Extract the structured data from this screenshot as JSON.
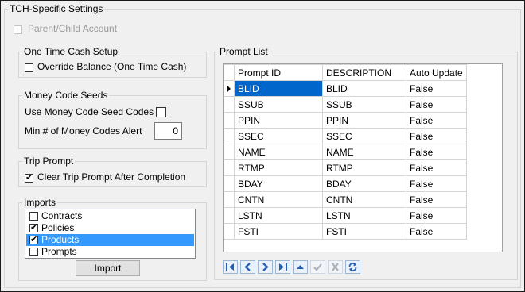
{
  "section_title": "TCH-Specific Settings",
  "parent_child": {
    "label": "Parent/Child Account",
    "checked": false,
    "enabled": false
  },
  "one_time_cash": {
    "title": "One Time Cash Setup",
    "override_label": "Override Balance (One Time Cash)",
    "override_checked": false
  },
  "money_code": {
    "title": "Money Code Seeds",
    "use_seed_label": "Use Money Code Seed Codes",
    "use_seed_checked": false,
    "min_label": "Min # of Money Codes Alert",
    "min_value": "0"
  },
  "trip_prompt": {
    "title": "Trip Prompt",
    "clear_label": "Clear Trip Prompt After Completion",
    "clear_checked": true
  },
  "imports": {
    "title": "Imports",
    "items": [
      {
        "label": "Contracts",
        "checked": false,
        "selected": false
      },
      {
        "label": "Policies",
        "checked": true,
        "selected": false
      },
      {
        "label": "Products",
        "checked": true,
        "selected": true
      },
      {
        "label": "Prompts",
        "checked": false,
        "selected": false
      }
    ],
    "import_button": "Import"
  },
  "prompt_list": {
    "title": "Prompt List",
    "columns": [
      "Prompt ID",
      "DESCRIPTION",
      "Auto Update"
    ],
    "rows": [
      [
        "BLID",
        "BLID",
        "False"
      ],
      [
        "SSUB",
        "SSUB",
        "False"
      ],
      [
        "PPIN",
        "PPIN",
        "False"
      ],
      [
        "SSEC",
        "SSEC",
        "False"
      ],
      [
        "NAME",
        "NAME",
        "False"
      ],
      [
        "RTMP",
        "RTMP",
        "False"
      ],
      [
        "BDAY",
        "BDAY",
        "False"
      ],
      [
        "CNTN",
        "CNTN",
        "False"
      ],
      [
        "LSTN",
        "LSTN",
        "False"
      ],
      [
        "FSTI",
        "FSTI",
        "False"
      ]
    ],
    "selected_row": 0
  },
  "navigator": [
    "first-record-icon",
    "prev-record-icon",
    "next-record-icon",
    "last-record-icon",
    "insert-record-icon",
    "post-edit-icon",
    "cancel-edit-icon",
    "refresh-icon"
  ],
  "colors": {
    "selection": "#3399ff",
    "grid_selection": "#0066cc",
    "nav_blue": "#1f5fb4"
  }
}
